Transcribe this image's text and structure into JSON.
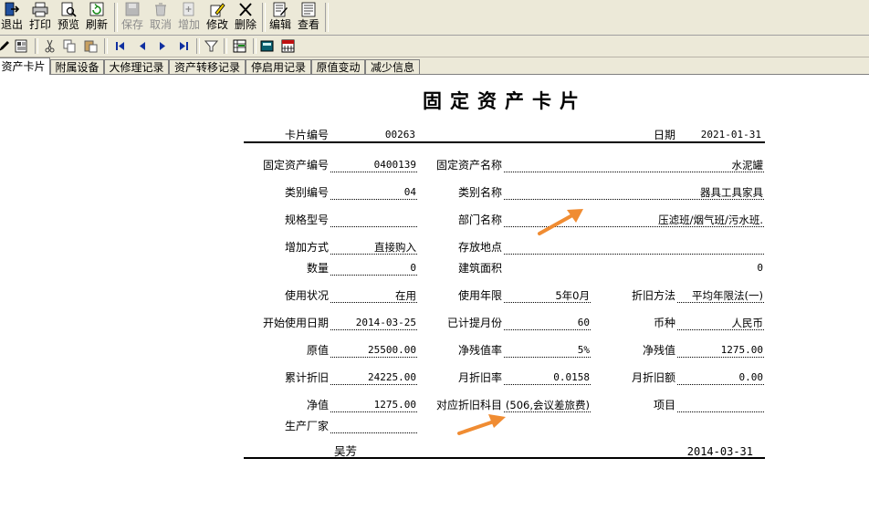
{
  "toolbar": {
    "exit": "退出",
    "print": "打印",
    "preview": "预览",
    "refresh": "刷新",
    "save": "保存",
    "cancel": "取消",
    "add": "增加",
    "modify": "修改",
    "delete": "删除",
    "edit": "编辑",
    "view": "查看"
  },
  "tabs": [
    "资产卡片",
    "附属设备",
    "大修理记录",
    "资产转移记录",
    "停启用记录",
    "原值变动",
    "减少信息"
  ],
  "card": {
    "title": "固定资产卡片",
    "card_no_label": "卡片编号",
    "card_no": "00263",
    "date_label": "日期",
    "date": "2021-01-31",
    "asset_code_label": "固定资产编号",
    "asset_code": "0400139",
    "asset_name_label": "固定资产名称",
    "asset_name": "水泥罐",
    "category_code_label": "类别编号",
    "category_code": "04",
    "category_name_label": "类别名称",
    "category_name": "器具工具家具",
    "spec_label": "规格型号",
    "spec": "",
    "dept_label": "部门名称",
    "dept": "压滤班/烟气班/污水班.",
    "add_method_label": "增加方式",
    "add_method": "直接购入",
    "location_label": "存放地点",
    "location": "",
    "quantity_label": "数量",
    "quantity": "0",
    "area_label": "建筑面积",
    "area": "0",
    "status_label": "使用状况",
    "status": "在用",
    "life_label": "使用年限",
    "life": "5年0月",
    "method_label": "折旧方法",
    "method": "平均年限法(一)",
    "start_date_label": "开始使用日期",
    "start_date": "2014-03-25",
    "months_label": "已计提月份",
    "months": "60",
    "currency_label": "币种",
    "currency": "人民币",
    "original_label": "原值",
    "original": "25500.00",
    "residual_rate_label": "净残值率",
    "residual_rate": "5%",
    "residual_label": "净残值",
    "residual": "1275.00",
    "accum_label": "累计折旧",
    "accum": "24225.00",
    "monthly_rate_label": "月折旧率",
    "monthly_rate": "0.0158",
    "monthly_amount_label": "月折旧额",
    "monthly_amount": "0.00",
    "net_label": "净值",
    "net": "1275.00",
    "account_label": "对应折旧科目",
    "account": "(506,会议差旅费)",
    "item_label": "项目",
    "item": "",
    "maker_label": "生产厂家",
    "maker": "",
    "operator": "吴芳",
    "entry_date": "2014-03-31"
  },
  "colors": {
    "toolbar_bg": "#ece9d8",
    "arrow": "#f08c32"
  }
}
